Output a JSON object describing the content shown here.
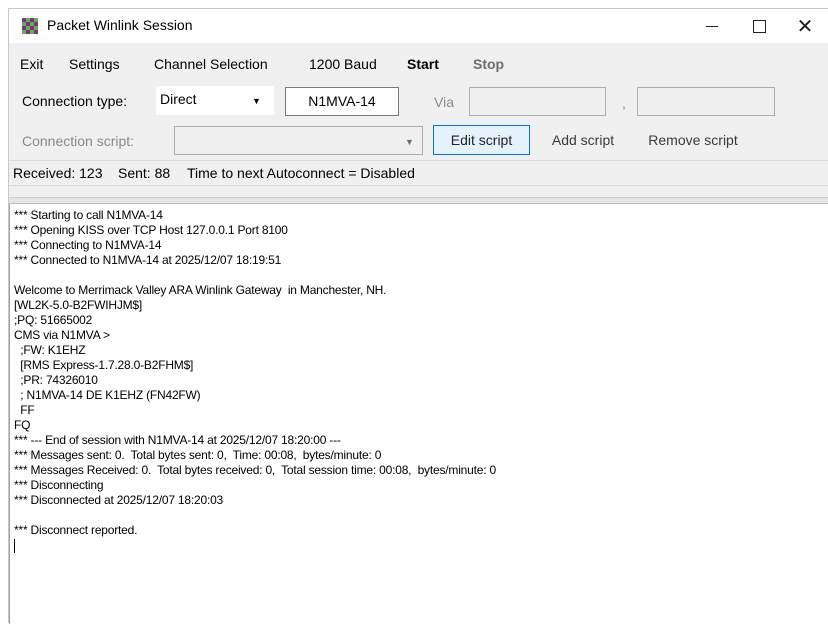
{
  "window": {
    "title": "Packet Winlink Session",
    "controls": {
      "minimize": "–",
      "maximize": "□",
      "close": "✕"
    },
    "icon_colors": [
      "#8b2a8a",
      "#54b948"
    ]
  },
  "menu": {
    "exit": "Exit",
    "settings": "Settings",
    "channel_selection": "Channel Selection",
    "baud": "1200 Baud",
    "start": "Start",
    "stop": "Stop"
  },
  "connection": {
    "type_label": "Connection type:",
    "type_value": "Direct",
    "callsign": "N1MVA-14",
    "via_label": "Via",
    "via_1": "",
    "comma": ",",
    "via_2": ""
  },
  "script": {
    "label": "Connection script:",
    "value": "",
    "edit_button": "Edit script",
    "add_button": "Add script",
    "remove_button": "Remove script"
  },
  "status": {
    "received": "Received: 123",
    "sent": "Sent: 88",
    "autoconnect": "Time to next Autoconnect = Disabled"
  },
  "log": {
    "lines": [
      "*** Starting to call N1MVA-14",
      "*** Opening KISS over TCP Host 127.0.0.1 Port 8100",
      "*** Connecting to N1MVA-14",
      "*** Connected to N1MVA-14 at 2025/12/07 18:19:51",
      "",
      "Welcome to Merrimack Valley ARA Winlink Gateway  in Manchester, NH.",
      "[WL2K-5.0-B2FWIHJM$]",
      ";PQ: 51665002",
      "CMS via N1MVA >",
      "  ;FW: K1EHZ",
      "  [RMS Express-1.7.28.0-B2FHM$]",
      "  ;PR: 74326010",
      "  ; N1MVA-14 DE K1EHZ (FN42FW)",
      "  FF",
      "FQ",
      "*** --- End of session with N1MVA-14 at 2025/12/07 18:20:00 ---",
      "*** Messages sent: 0.  Total bytes sent: 0,  Time: 00:08,  bytes/minute: 0",
      "*** Messages Received: 0.  Total bytes received: 0,  Total session time: 00:08,  bytes/minute: 0",
      "*** Disconnecting",
      "*** Disconnected at 2025/12/07 18:20:03",
      "",
      "*** Disconnect reported."
    ]
  }
}
